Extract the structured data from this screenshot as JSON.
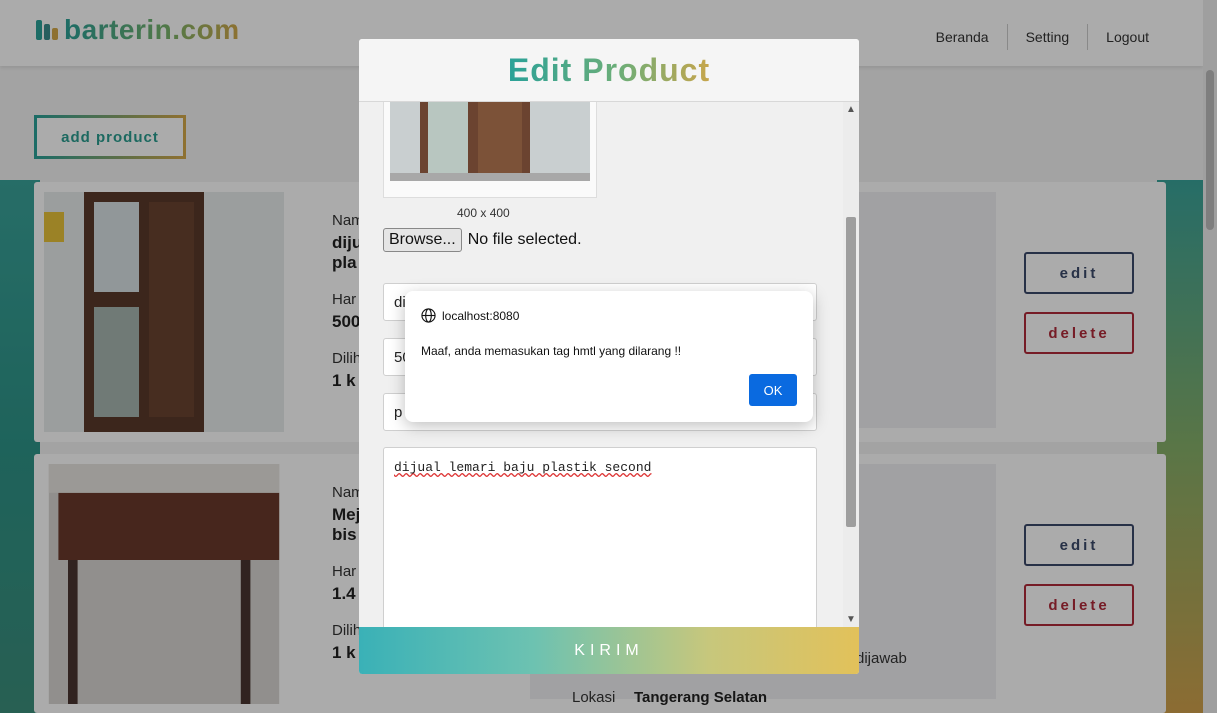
{
  "brand": {
    "name": "barterin.com"
  },
  "nav": {
    "items": [
      "Beranda",
      "Setting",
      "Logout"
    ]
  },
  "add_button": "add product",
  "products": [
    {
      "name_label": "Nam",
      "name_value_1": "diju",
      "name_value_2": "pla",
      "price_label": "Har",
      "price_value": "500",
      "seen_label": "Dilih",
      "seen_value": "1 k",
      "edit": "edit",
      "delete": "delete"
    },
    {
      "name_label": "Nam",
      "name_value_1": "Mej",
      "name_value_2": "bis",
      "price_label": "Har",
      "price_value": "1.4",
      "seen_label": "Dilih",
      "seen_value": "1 k",
      "edit": "edit",
      "delete": "delete",
      "desc_fragment": "dijawab",
      "location_label": "Lokasi",
      "location_value": "Tangerang Selatan"
    }
  ],
  "modal": {
    "title": "Edit Product",
    "image_size": "400 x 400",
    "browse_label": "Browse...",
    "file_status": "No file selected.",
    "field_values": [
      "dij",
      "50",
      "p"
    ],
    "description": "dijual lemari baju plastik second",
    "submit": "KIRIM"
  },
  "alert": {
    "origin": "localhost:8080",
    "message": "Maaf, anda memasukan tag hmtl yang dilarang !!",
    "ok": "OK"
  }
}
